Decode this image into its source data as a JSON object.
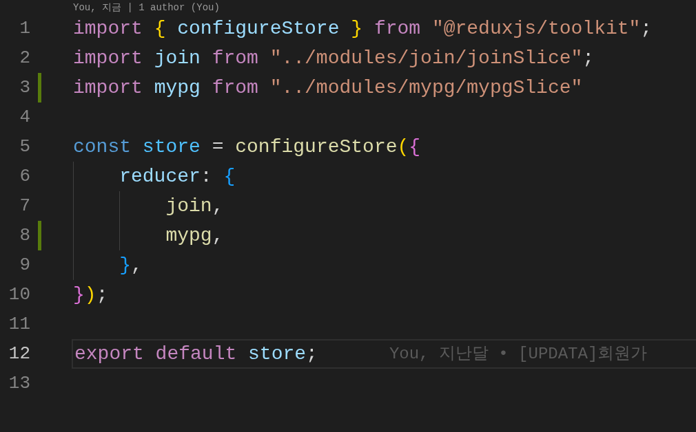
{
  "codelens": "You, 지금 | 1 author (You)",
  "lines": [
    {
      "number": "1",
      "changed": false,
      "current": false,
      "tokens": [
        {
          "text": "import ",
          "kind": "keyword"
        },
        {
          "text": "{ ",
          "kind": "bracket1"
        },
        {
          "text": "configureStore ",
          "kind": "variable"
        },
        {
          "text": "} ",
          "kind": "bracket1"
        },
        {
          "text": "from ",
          "kind": "keyword"
        },
        {
          "text": "\"@reduxjs/toolkit\"",
          "kind": "string"
        },
        {
          "text": ";",
          "kind": "punct"
        }
      ]
    },
    {
      "number": "2",
      "changed": false,
      "current": false,
      "tokens": [
        {
          "text": "import ",
          "kind": "keyword"
        },
        {
          "text": "join ",
          "kind": "variable"
        },
        {
          "text": "from ",
          "kind": "keyword"
        },
        {
          "text": "\"../modules/join/joinSlice\"",
          "kind": "string"
        },
        {
          "text": ";",
          "kind": "punct"
        }
      ]
    },
    {
      "number": "3",
      "changed": true,
      "current": false,
      "tokens": [
        {
          "text": "import ",
          "kind": "keyword"
        },
        {
          "text": "mypg ",
          "kind": "variable"
        },
        {
          "text": "from ",
          "kind": "keyword"
        },
        {
          "text": "\"../modules/mypg/mypgSlice\"",
          "kind": "string"
        }
      ]
    },
    {
      "number": "4",
      "changed": false,
      "current": false
    },
    {
      "number": "5",
      "changed": false,
      "current": false,
      "tokens": [
        {
          "text": "const ",
          "kind": "storage"
        },
        {
          "text": "store ",
          "kind": "constant"
        },
        {
          "text": "= ",
          "kind": "punct"
        },
        {
          "text": "configureStore",
          "kind": "function"
        },
        {
          "text": "(",
          "kind": "bracket1"
        },
        {
          "text": "{",
          "kind": "bracket2"
        }
      ],
      "children": [
        {
          "number": "6",
          "changed": false,
          "current": false,
          "tokens": [
            {
              "text": "reducer",
              "kind": "variable"
            },
            {
              "text": ": ",
              "kind": "punct"
            },
            {
              "text": "{",
              "kind": "bracket3"
            }
          ],
          "children": [
            {
              "number": "7",
              "changed": false,
              "current": false,
              "tokens": [
                {
                  "text": "join",
                  "kind": "function"
                },
                {
                  "text": ",",
                  "kind": "punct"
                }
              ]
            },
            {
              "number": "8",
              "changed": true,
              "current": false,
              "tokens": [
                {
                  "text": "mypg",
                  "kind": "function"
                },
                {
                  "text": ",",
                  "kind": "punct"
                }
              ]
            }
          ]
        },
        {
          "number": "9",
          "changed": false,
          "current": false,
          "tokens": [
            {
              "text": "}",
              "kind": "bracket3"
            },
            {
              "text": ",",
              "kind": "punct"
            }
          ]
        }
      ]
    },
    {
      "number": "10",
      "changed": false,
      "current": false,
      "tokens": [
        {
          "text": "}",
          "kind": "bracket2"
        },
        {
          "text": ")",
          "kind": "bracket1"
        },
        {
          "text": ";",
          "kind": "punct"
        }
      ]
    },
    {
      "number": "11",
      "changed": false,
      "current": false
    },
    {
      "number": "12",
      "changed": false,
      "current": true,
      "tokens": [
        {
          "text": "export default ",
          "kind": "keyword"
        },
        {
          "text": "store",
          "kind": "variable"
        },
        {
          "text": ";",
          "kind": "punct"
        }
      ],
      "blame": "You, 지난달 • [UPDATA]회원가"
    },
    {
      "number": "13",
      "changed": false,
      "current": false
    }
  ]
}
